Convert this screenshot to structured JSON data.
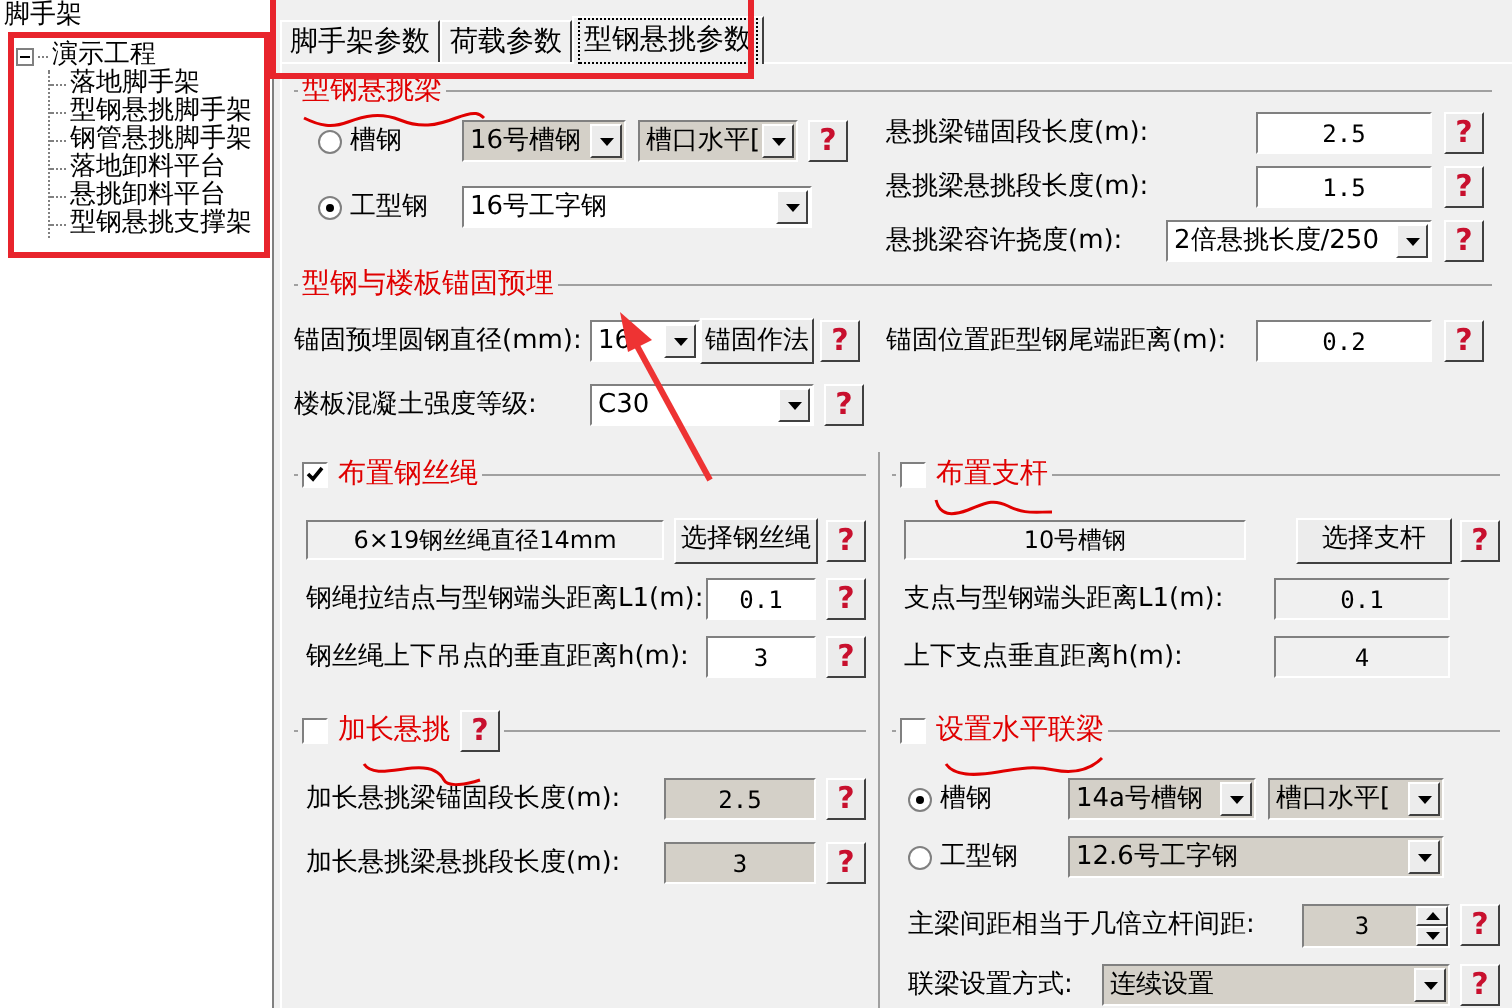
{
  "tree": {
    "label": "脚手架",
    "children": [
      {
        "label": "演示工程",
        "expanded": true,
        "children": [
          {
            "label": "落地脚手架"
          },
          {
            "label": "型钢悬挑脚手架"
          },
          {
            "label": "钢管悬挑脚手架"
          },
          {
            "label": "落地卸料平台"
          },
          {
            "label": "悬挑卸料平台"
          },
          {
            "label": "型钢悬挑支撑架"
          }
        ]
      }
    ]
  },
  "tabs": [
    {
      "label": "脚手架参数",
      "selected": false
    },
    {
      "label": "荷载参数",
      "selected": false
    },
    {
      "label": "型钢悬挑参数",
      "selected": true
    }
  ],
  "beam_group": {
    "title": "型钢悬挑梁",
    "options": [
      {
        "label": "槽钢",
        "selected": false,
        "selects": [
          "16号槽钢",
          "槽口水平["
        ],
        "help": "?"
      },
      {
        "label": "工型钢",
        "selected": true,
        "selects": [
          "16号工字钢"
        ]
      }
    ],
    "fields": [
      {
        "label": "悬挑梁锚固段长度(m):",
        "kind": "input",
        "value": "2.5",
        "help": "?"
      },
      {
        "label": "悬挑梁悬挑段长度(m):",
        "kind": "input",
        "value": "1.5",
        "help": "?"
      },
      {
        "label": "悬挑梁容许挠度(m):",
        "kind": "select",
        "value": "2倍悬挑长度/250",
        "help": "?"
      }
    ]
  },
  "anchor_group": {
    "title": "型钢与楼板锚固预埋",
    "fields": [
      {
        "label": "锚固预埋圆钢直径(mm):",
        "kind": "select",
        "value": "16",
        "button": "锚固作法",
        "help": "?"
      },
      {
        "label": "楼板混凝土强度等级:",
        "kind": "select",
        "value": "C30",
        "help": "?"
      },
      {
        "label": "锚固位置距型钢尾端距离(m):",
        "kind": "input",
        "value": "0.2",
        "help": "?"
      }
    ]
  },
  "rope_group": {
    "title": "布置钢丝绳",
    "checked": true,
    "display": "6×19钢丝绳直径14mm",
    "button": "选择钢丝绳",
    "help": "?",
    "fields": [
      {
        "label": "钢绳拉结点与型钢端头距离L1(m):",
        "kind": "input",
        "value": "0.1",
        "help": "?"
      },
      {
        "label": "钢丝绳上下吊点的垂直距离h(m):",
        "kind": "input",
        "value": "3",
        "help": "?"
      }
    ]
  },
  "extend_group": {
    "title": "加长悬挑",
    "checked": false,
    "help": "?",
    "fields": [
      {
        "label": "加长悬挑梁锚固段长度(m):",
        "kind": "input",
        "value": "2.5",
        "disabled": true,
        "help": "?"
      },
      {
        "label": "加长悬挑梁悬挑段长度(m):",
        "kind": "input",
        "value": "3",
        "disabled": true,
        "help": "?"
      }
    ]
  },
  "brace_group": {
    "title": "布置支杆",
    "checked": false,
    "display": "10号槽钢",
    "button": "选择支杆",
    "help": "?",
    "fields": [
      {
        "label": "支点与型钢端头距离L1(m):",
        "kind": "readonly",
        "value": "0.1"
      },
      {
        "label": "上下支点垂直距离h(m):",
        "kind": "readonly",
        "value": "4"
      }
    ]
  },
  "tie_group": {
    "title": "设置水平联梁",
    "checked": false,
    "options": [
      {
        "label": "槽钢",
        "selected": true,
        "selects": [
          "14a号槽钢",
          "槽口水平["
        ]
      },
      {
        "label": "工型钢",
        "selected": false,
        "selects": [
          "12.6号工字钢"
        ]
      }
    ],
    "fields": [
      {
        "label": "主梁间距相当于几倍立杆间距:",
        "kind": "spinner",
        "value": "3",
        "disabled": true,
        "help": "?"
      },
      {
        "label": "联梁设置方式:",
        "kind": "select",
        "value": "连续设置",
        "disabled": true,
        "help": "?"
      }
    ]
  }
}
